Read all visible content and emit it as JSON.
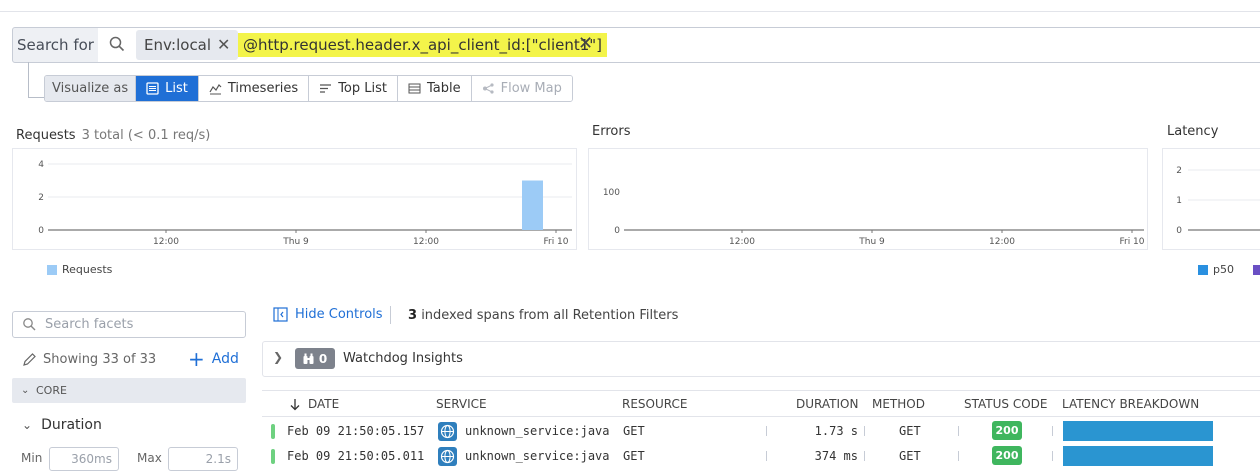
{
  "search": {
    "label": "Search for",
    "env_pill": "Env:local",
    "query": "@http.request.header.x_api_client_id:[\"client1\"]"
  },
  "visualize": {
    "label": "Visualize as",
    "options": [
      {
        "label": "List",
        "icon": "list-icon",
        "active": true
      },
      {
        "label": "Timeseries",
        "icon": "timeseries-icon",
        "active": false
      },
      {
        "label": "Top List",
        "icon": "toplist-icon",
        "active": false
      },
      {
        "label": "Table",
        "icon": "table-icon",
        "active": false
      },
      {
        "label": "Flow Map",
        "icon": "flowmap-icon",
        "active": false,
        "disabled": true
      }
    ]
  },
  "charts": {
    "requests": {
      "title": "Requests",
      "subtitle": "3 total (< 0.1 req/s)",
      "legend": "Requests"
    },
    "errors": {
      "title": "Errors"
    },
    "latency": {
      "title": "Latency",
      "legend": "p50"
    }
  },
  "chart_data": [
    {
      "type": "bar",
      "title": "Requests",
      "x_ticks": [
        "12:00",
        "Thu 9",
        "12:00",
        "Fri 10"
      ],
      "y_ticks": [
        "0",
        "2",
        "4"
      ],
      "ylim": [
        0,
        4
      ],
      "series": [
        {
          "name": "Requests",
          "values": [
            3
          ],
          "x": [
            "Fri 10 (just before)"
          ]
        }
      ],
      "colors": {
        "Requests": "#9ccbf6"
      },
      "legend_position": "bottom-left"
    },
    {
      "type": "line",
      "title": "Errors",
      "x_ticks": [
        "12:00",
        "Thu 9",
        "12:00",
        "Fri 10"
      ],
      "y_ticks": [
        "0",
        "100"
      ],
      "series": []
    },
    {
      "type": "line",
      "title": "Latency",
      "y_ticks": [
        "0",
        "1",
        "2"
      ],
      "series": [
        {
          "name": "p50",
          "values": []
        }
      ],
      "colors": {
        "p50": "#2a90e0"
      },
      "legend_position": "bottom"
    }
  ],
  "facets": {
    "search_placeholder": "Search facets",
    "showing": "Showing 33 of 33",
    "add_label": "Add",
    "core_label": "CORE",
    "duration_label": "Duration",
    "min_label": "Min",
    "min_placeholder": "360ms",
    "max_label": "Max",
    "max_placeholder": "2.1s"
  },
  "controls": {
    "hide_label": "Hide Controls",
    "indexed_count": "3",
    "indexed_text": "indexed spans from all Retention Filters"
  },
  "watchdog": {
    "count": "0",
    "label": "Watchdog Insights"
  },
  "table": {
    "columns": [
      "DATE",
      "SERVICE",
      "RESOURCE",
      "DURATION",
      "METHOD",
      "STATUS CODE",
      "LATENCY BREAKDOWN"
    ],
    "rows": [
      {
        "date": "Feb 09 21:50:05.157",
        "service": "unknown_service:java",
        "resource": "GET",
        "duration": "1.73 s",
        "method": "GET",
        "status": "200",
        "status_color": "#3fb65e"
      },
      {
        "date": "Feb 09 21:50:05.011",
        "service": "unknown_service:java",
        "resource": "GET",
        "duration": "374 ms",
        "method": "GET",
        "status": "200",
        "status_color": "#3fb65e"
      }
    ]
  }
}
